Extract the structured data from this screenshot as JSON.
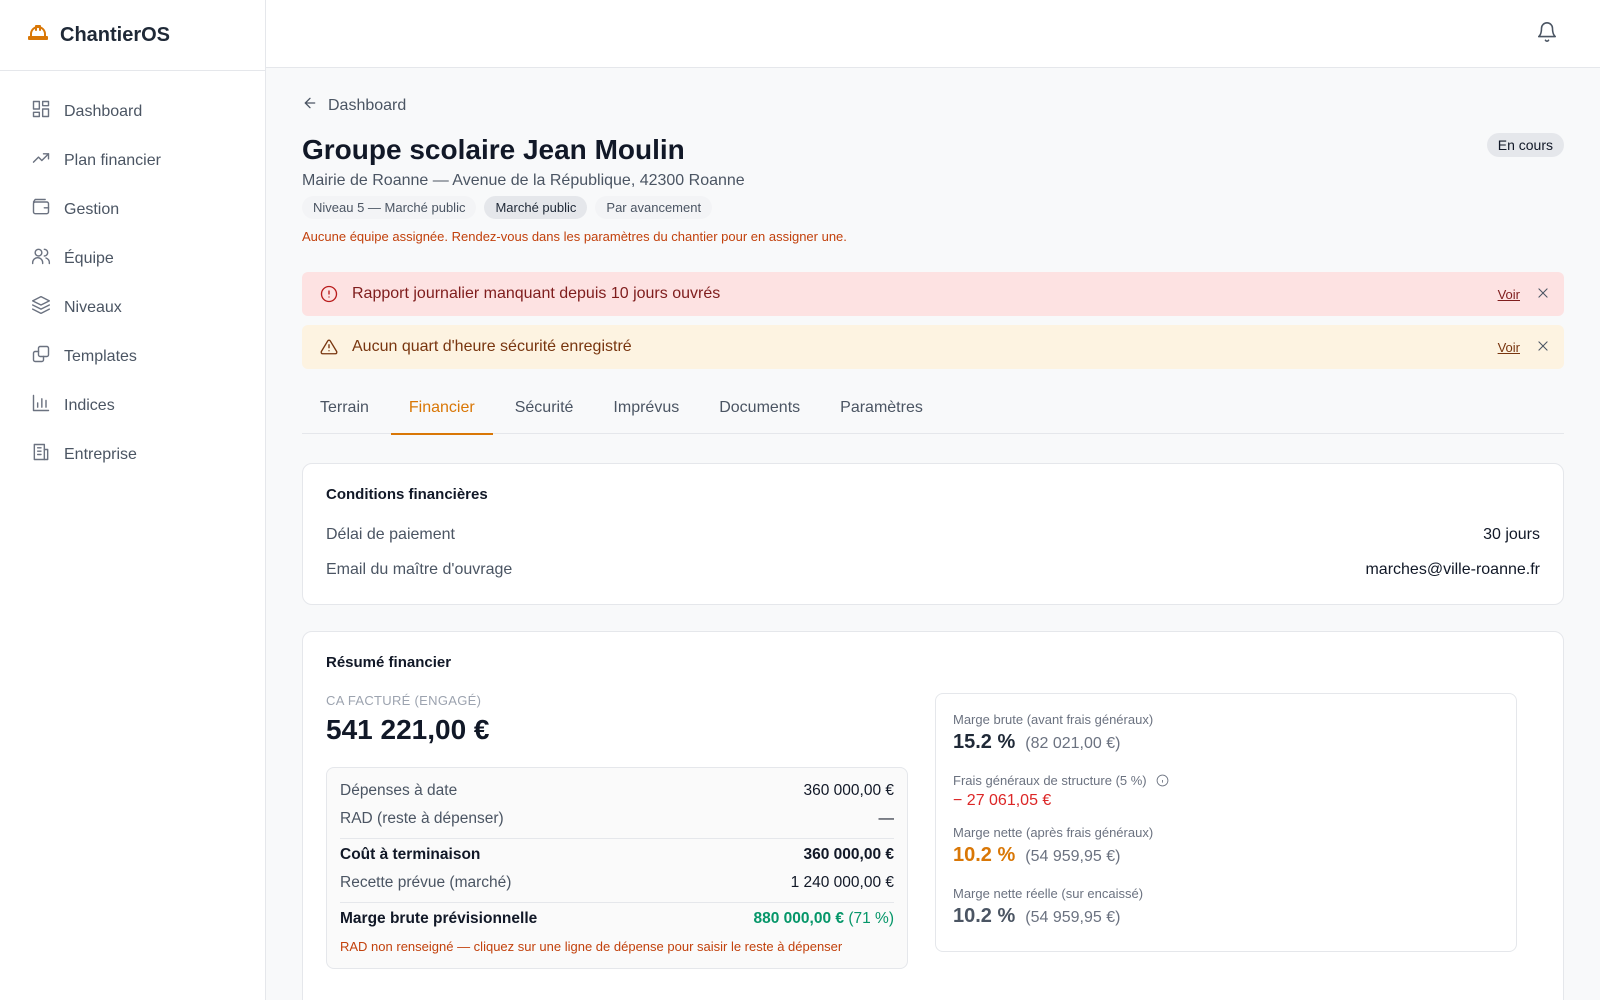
{
  "app": {
    "name": "ChantierOS",
    "accent": "#d97706"
  },
  "sidebar": {
    "items": [
      {
        "label": "Dashboard",
        "icon": "dashboard-icon"
      },
      {
        "label": "Plan financier",
        "icon": "trending-up-icon"
      },
      {
        "label": "Gestion",
        "icon": "wallet-icon"
      },
      {
        "label": "Équipe",
        "icon": "users-icon"
      },
      {
        "label": "Niveaux",
        "icon": "layers-icon"
      },
      {
        "label": "Templates",
        "icon": "copy-icon"
      },
      {
        "label": "Indices",
        "icon": "bar-chart-icon"
      },
      {
        "label": "Entreprise",
        "icon": "building-icon"
      }
    ]
  },
  "breadcrumb": {
    "back_label": "Dashboard"
  },
  "project": {
    "title": "Groupe scolaire Jean Moulin",
    "status": "En cours",
    "address": "Mairie de Roanne — Avenue de la République, 42300 Roanne",
    "chips": [
      "Niveau 5 — Marché public",
      "Marché public",
      "Par avancement"
    ],
    "team_warning": "Aucune équipe assignée. Rendez-vous dans les paramètres du chantier pour en assigner une."
  },
  "alerts": [
    {
      "text": "Rapport journalier manquant depuis 10 jours ouvrés",
      "action": "Voir",
      "level": "error"
    },
    {
      "text": "Aucun quart d'heure sécurité enregistré",
      "action": "Voir",
      "level": "warning"
    }
  ],
  "tabs": [
    "Terrain",
    "Financier",
    "Sécurité",
    "Imprévus",
    "Documents",
    "Paramètres"
  ],
  "active_tab": "Financier",
  "conditions": {
    "title": "Conditions financières",
    "rows": [
      {
        "label": "Délai de paiement",
        "value": "30 jours"
      },
      {
        "label": "Email du maître d'ouvrage",
        "value": "marches@ville-roanne.fr"
      }
    ]
  },
  "summary": {
    "title": "Résumé financier",
    "ca_label": "CA FACTURÉ (ENGAGÉ)",
    "ca_value": "541 221,00 €",
    "rows": {
      "depenses": {
        "label": "Dépenses à date",
        "value": "360 000,00 €"
      },
      "rad": {
        "label": "RAD (reste à dépenser)",
        "value": "—"
      },
      "cout": {
        "label": "Coût à terminaison",
        "value": "360 000,00 €"
      },
      "recette": {
        "label": "Recette prévue (marché)",
        "value": "1 240 000,00 €"
      },
      "marge": {
        "label": "Marge brute prévisionnelle",
        "value": "880 000,00 €",
        "pct": "(71 %)"
      }
    },
    "rad_note": "RAD non renseigné — cliquez sur une ligne de dépense pour saisir le reste à dépenser",
    "margins": {
      "brute": {
        "label": "Marge brute (avant frais généraux)",
        "value": "15.2 %",
        "sub": "(82 021,00 €)"
      },
      "frais": {
        "label": "Frais généraux de structure (5 %)",
        "value": "− 27 061,05 €"
      },
      "nette": {
        "label": "Marge nette (après frais généraux)",
        "value": "10.2 %",
        "sub": "(54 959,95 €)"
      },
      "reelle": {
        "label": "Marge nette réelle (sur encaissé)",
        "value": "10.2 %",
        "sub": "(54 959,95 €)"
      }
    }
  }
}
